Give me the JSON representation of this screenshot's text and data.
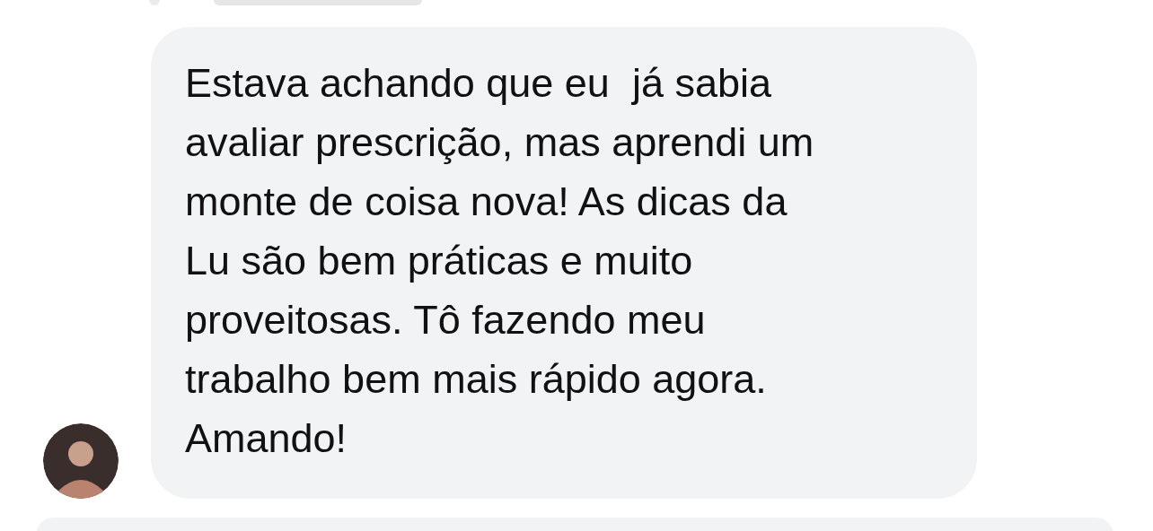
{
  "message": {
    "text": "Estava achando que eu  já sabia\navaliar prescrição, mas aprendi um\nmonte de coisa nova! As dicas da\nLu são bem práticas e muito\nproveitosas. Tô fazendo meu\ntrabalho bem mais rápido agora.\nAmando!"
  }
}
